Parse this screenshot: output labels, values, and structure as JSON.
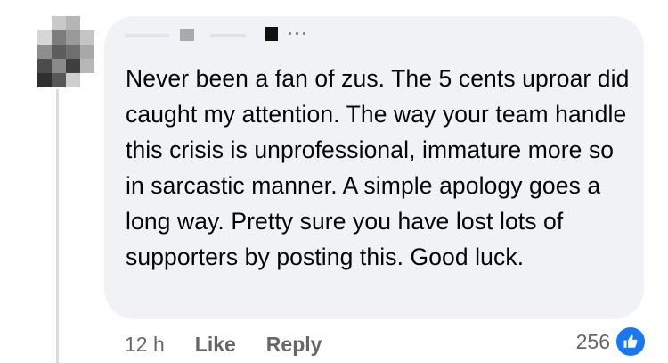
{
  "comment": {
    "text": "Never been a fan of zus. The 5 cents uproar did caught my attention. The way your team handle this crisis is unprofessional, immature more so in sarcastic manner. A simple apology goes a long way. Pretty sure you have lost lots of supporters by posting this. Good luck.",
    "time": "12 h",
    "like_label": "Like",
    "reply_label": "Reply",
    "reaction_count": "256",
    "reaction_icon": "thumbs-up-icon"
  },
  "colors": {
    "bubble": "#f0f2f5",
    "text": "#050505",
    "meta": "#65676b",
    "accent": "#1877f2"
  }
}
